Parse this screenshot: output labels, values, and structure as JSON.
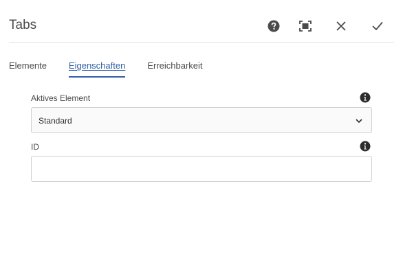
{
  "dialog": {
    "title": "Tabs",
    "actions": [
      {
        "name": "help",
        "icon": "help-icon"
      },
      {
        "name": "fullscreen",
        "icon": "fullscreen-icon"
      },
      {
        "name": "close",
        "icon": "close-icon"
      },
      {
        "name": "done",
        "icon": "checkmark-icon"
      }
    ]
  },
  "tabs": [
    {
      "label": "Elemente",
      "active": false
    },
    {
      "label": "Eigenschaften",
      "active": true
    },
    {
      "label": "Erreichbarkeit",
      "active": false
    }
  ],
  "form": {
    "active_element": {
      "label": "Aktives Element",
      "value": "Standard",
      "icon": "info-icon"
    },
    "id": {
      "label": "ID",
      "value": "",
      "icon": "info-icon"
    }
  },
  "colors": {
    "accent": "#2f5fa8",
    "text": "#2c2c2c",
    "border": "#cfcfcf"
  }
}
